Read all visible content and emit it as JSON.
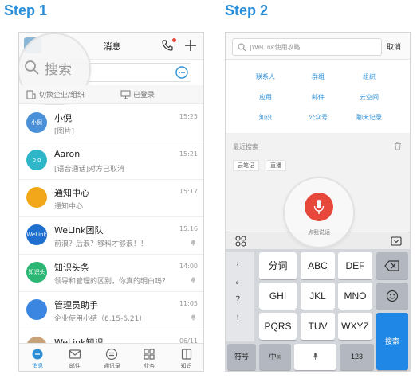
{
  "step1": {
    "title": "Step 1"
  },
  "step2": {
    "title": "Step 2"
  },
  "phone1": {
    "header": {
      "title": "消息"
    },
    "search": {
      "magnified_text": "搜索"
    },
    "subbar": {
      "switch_label": "切换企业/组织",
      "login_status": "已登录"
    },
    "messages": [
      {
        "name": "小倪",
        "preview": "[图片]",
        "time": "15:25",
        "avatar_text": "小倪",
        "avatar_color": "#4a90d9",
        "muted": false
      },
      {
        "name": "Aaron",
        "preview": "[语音通话]对方已取消",
        "time": "15:21",
        "avatar_text": "o o",
        "avatar_color": "#2fb5c8",
        "muted": false
      },
      {
        "name": "通知中心",
        "preview": "通知中心",
        "time": "15:17",
        "avatar_text": "",
        "avatar_color": "#f2a71b",
        "muted": false
      },
      {
        "name": "WeLink团队",
        "preview": "前浪？后浪？够科才够浪！！",
        "time": "15:16",
        "avatar_text": "WeLink",
        "avatar_color": "#1f6fd1",
        "muted": true
      },
      {
        "name": "知识头条",
        "preview": "领导和管理的区别，你真的明白吗？",
        "time": "14:00",
        "avatar_text": "知识头条",
        "avatar_color": "#2bb673",
        "muted": true
      },
      {
        "name": "管理员助手",
        "preview": "企业使用小结（6.15-6.21）",
        "time": "11:05",
        "avatar_text": "",
        "avatar_color": "#3a86e0",
        "muted": true
      },
      {
        "name": "WeLink知识",
        "preview": "",
        "time": "06/11",
        "avatar_text": "",
        "avatar_color": "#c8a27a",
        "muted": false
      }
    ],
    "tabs": [
      {
        "label": "消息",
        "icon": "message-icon",
        "active": true
      },
      {
        "label": "邮件",
        "icon": "mail-icon",
        "active": false
      },
      {
        "label": "通讯录",
        "icon": "contacts-icon",
        "active": false
      },
      {
        "label": "业务",
        "icon": "grid-icon",
        "active": false
      },
      {
        "label": "知识",
        "icon": "book-icon",
        "active": false
      }
    ]
  },
  "phone2": {
    "search": {
      "placeholder": "|WeLink使用攻略",
      "cancel": "取消"
    },
    "categories": [
      [
        "联系人",
        "群组",
        "组织"
      ],
      [
        "应用",
        "邮件",
        "云空间"
      ],
      [
        "知识",
        "公众号",
        "聊天记录"
      ]
    ],
    "recent": {
      "title": "最近搜索",
      "chips": [
        "云笔记",
        "直播"
      ]
    },
    "voice": {
      "label": "点我说话"
    },
    "keyboard": {
      "symbols": [
        "，",
        "。",
        "？",
        "！"
      ],
      "rows": [
        [
          "分词",
          "ABC",
          "DEF"
        ],
        [
          "GHI",
          "JKL",
          "MNO"
        ],
        [
          "PQRS",
          "TUV",
          "WXYZ"
        ]
      ],
      "bottom": {
        "symbol_key": "符号",
        "lang_key": "中",
        "lang_sub": "英",
        "num_key": "123",
        "search_key": "搜索"
      }
    }
  }
}
